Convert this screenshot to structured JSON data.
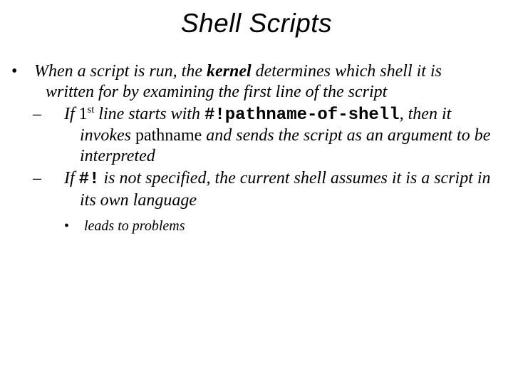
{
  "title": "Shell Scripts",
  "bullet": "•",
  "dash": "–",
  "p1_a": "When a script is run, the ",
  "p1_b": "kernel",
  "p1_c": " determines which shell it is written for by examining the first line of the script",
  "p2_a": "If ",
  "p2_b": "1",
  "p2_c": "st",
  "p2_d": " line starts with ",
  "p2_e": "#!pathname-of-shell",
  "p2_f": ", then it invokes ",
  "p2_g": "pathname",
  "p2_h": " and sends the script as an argument to be interpreted",
  "p3_a": "If ",
  "p3_b": "#!",
  "p3_c": " is not specified, the current shell assumes it is a script in its own language",
  "p4": "leads to problems"
}
